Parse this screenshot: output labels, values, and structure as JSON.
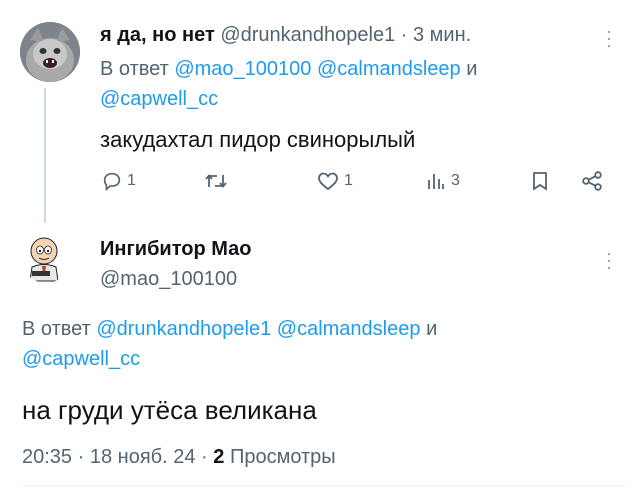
{
  "tweet1": {
    "display_name": "я да, но нет",
    "handle": "@drunkandhopele1",
    "separator": "·",
    "time": "3 мин.",
    "reply_prefix": "В ответ",
    "reply_mentions": [
      "@mao_100100",
      "@calmandsleep",
      "@capwell_cc"
    ],
    "reply_conjunction": "и",
    "text": "закудахтал пидор свинорылый",
    "actions": {
      "reply_count": "1",
      "retweet_count": "",
      "like_count": "1",
      "views_count": "3"
    }
  },
  "tweet2": {
    "display_name": "Ингибитор Мао",
    "handle": "@mao_100100",
    "reply_prefix": "В ответ",
    "reply_mentions": [
      "@drunkandhopele1",
      "@calmandsleep",
      "@capwell_cc"
    ],
    "reply_conjunction": "и",
    "text": "на груди утёса великана",
    "time": "20:35",
    "separator": "·",
    "date": "18 нояб. 24",
    "views_count": "2",
    "views_label": "Просмотры"
  },
  "icons": [
    "reply-icon",
    "retweet-icon",
    "like-icon",
    "views-icon",
    "bookmark-icon",
    "share-icon",
    "more-icon"
  ],
  "colors": {
    "link": "#1d9bf0",
    "muted": "#536471",
    "text": "#0f1419"
  }
}
